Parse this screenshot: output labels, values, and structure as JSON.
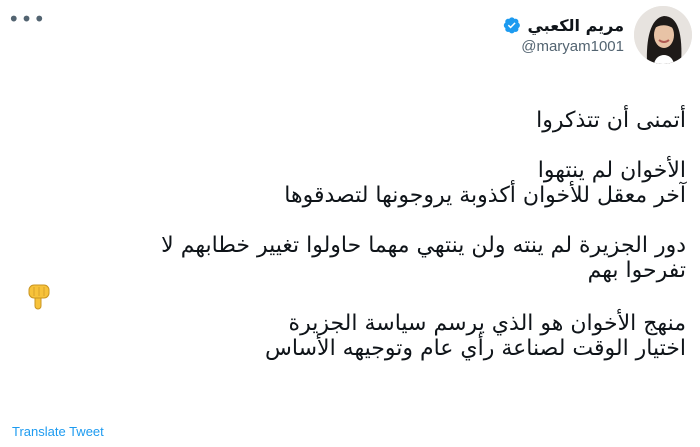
{
  "author": {
    "display_name": "مريم الكعبي",
    "handle": "@maryam1001",
    "verified": true
  },
  "tweet": {
    "paragraphs": [
      [
        "أتمنى أن تتذكروا"
      ],
      [
        "الأخوان لم ينتهوا",
        "آخر معقل للأخوان أكذوبة يروجونها لتصدقوها"
      ],
      [
        "دور الجزيرة لم ينته ولن ينتهي مهما حاولوا تغيير خطابهم لا",
        "تفرحوا بهم"
      ],
      [
        "منهج الأخوان هو الذي يرسم سياسة الجزيرة",
        "اختيار الوقت لصناعة رأي عام وتوجيهه الأساس"
      ]
    ],
    "emoji": "backhand-index-pointing-down"
  },
  "actions": {
    "translate_label": "Translate Tweet",
    "more_icon": "more-horizontal-icon"
  },
  "colors": {
    "accent": "#1d9bf0",
    "text": "#0f1419",
    "secondary": "#536471",
    "emoji": "#f7c23a"
  }
}
